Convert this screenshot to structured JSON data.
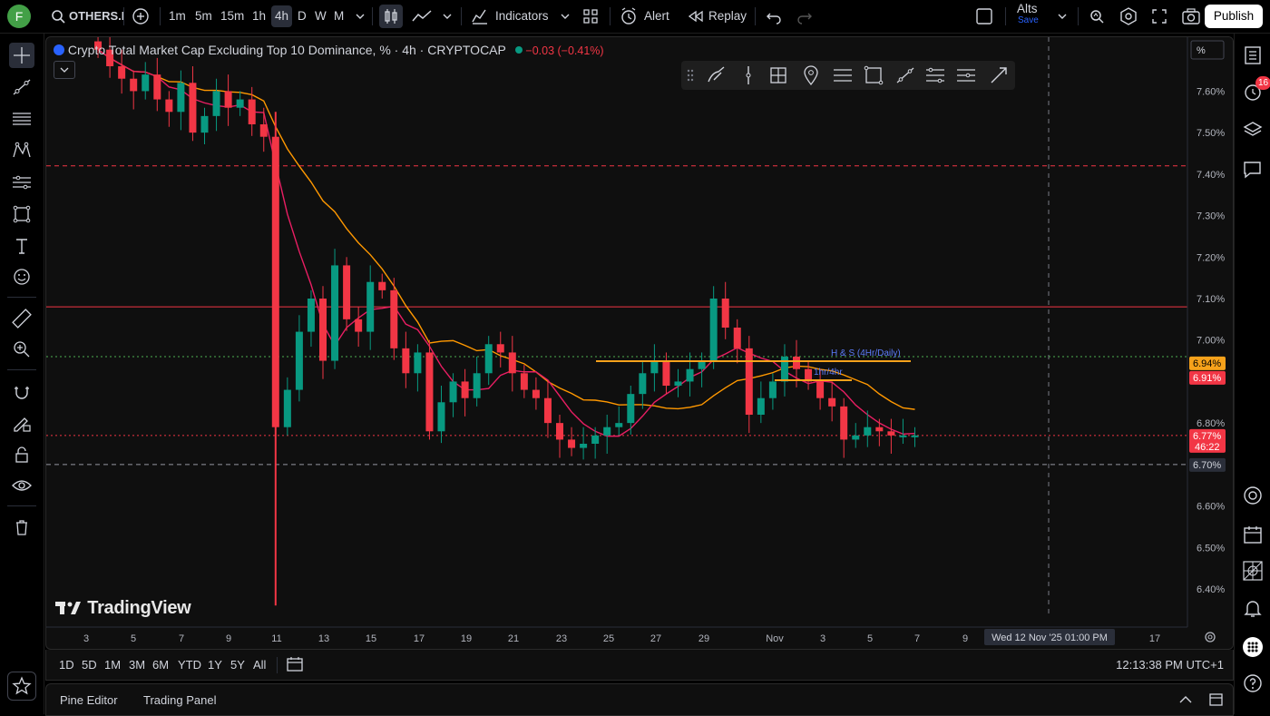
{
  "toolbar": {
    "avatar_letter": "F",
    "symbol": "OTHERS.I",
    "timeframes": [
      "1m",
      "5m",
      "15m",
      "1h",
      "4h",
      "D",
      "W",
      "M"
    ],
    "active_timeframe": "4h",
    "indicators_label": "Indicators",
    "alert_label": "Alert",
    "replay_label": "Replay",
    "layout_name": "Alts",
    "layout_status": "Save",
    "publish_label": "Publish"
  },
  "legend": {
    "title": "Crypto Total Market Cap Excluding Top 10 Dominance, % · 4h · CRYPTOCAP",
    "change": "−0.03 (−0.41%)"
  },
  "price_axis": {
    "unit_label": "%",
    "ticks": [
      "7.60%",
      "7.50%",
      "7.40%",
      "7.30%",
      "7.20%",
      "7.10%",
      "7.00%",
      "6.80%",
      "6.60%",
      "6.50%",
      "6.40%"
    ],
    "tags": [
      {
        "text": "6.94%",
        "bg": "#f7a21b",
        "fg": "#000000"
      },
      {
        "text": "6.91%",
        "bg": "#f23645",
        "fg": "#ffffff"
      },
      {
        "text": "6.77%",
        "text2": "46:22",
        "bg": "#f23645",
        "fg": "#ffffff"
      },
      {
        "text": "6.70%",
        "bg": "#2a2e39",
        "fg": "#d1d4dc"
      }
    ]
  },
  "time_axis": {
    "ticks": [
      "3",
      "5",
      "7",
      "9",
      "11",
      "13",
      "15",
      "17",
      "19",
      "21",
      "23",
      "25",
      "27",
      "29",
      "Nov",
      "3",
      "5",
      "7",
      "9",
      "17"
    ],
    "crosshair_label": "Wed 12 Nov '25    01:00 PM"
  },
  "annotations": {
    "hs_label": "H & S (4Hr/Daily)",
    "tf_label": "1hr/4hr"
  },
  "chart_data": {
    "type": "candlestick",
    "title": "Crypto Total Market Cap Excluding Top 10 Dominance, % · 4h · CRYPTOCAP",
    "y_unit": "%",
    "ylim": [
      6.33,
      7.73
    ],
    "x_range": [
      "Oct 2",
      "Nov 18"
    ],
    "horizontal_lines": [
      {
        "value": 7.42,
        "style": "dashed",
        "color": "#f23645"
      },
      {
        "value": 7.08,
        "style": "solid",
        "color": "#f23645"
      },
      {
        "value": 6.96,
        "style": "dotted",
        "color": "#4caf50"
      },
      {
        "value": 6.77,
        "style": "dotted",
        "color": "#f23645"
      },
      {
        "value": 6.7,
        "style": "dashed",
        "color": "#9598a1"
      }
    ],
    "series": [
      {
        "name": "close",
        "x_days": [
          0.5,
          1.0,
          1.5,
          2.0,
          2.5,
          3.0,
          3.5,
          4.0,
          4.5,
          5.0,
          5.5,
          6.0,
          6.5,
          7.0,
          7.5,
          8.0,
          8.5,
          9.0,
          9.5,
          10.0,
          10.5,
          11.0,
          11.5,
          12.0,
          12.5,
          13.0,
          13.5,
          14.0,
          14.5,
          15.0,
          15.5,
          16.0,
          16.5,
          17.0,
          17.5,
          18.0,
          18.5,
          19.0,
          19.5,
          20.0,
          20.5,
          21.0,
          21.5,
          22.0,
          22.5,
          23.0,
          23.5,
          24.0,
          24.5,
          25.0,
          25.5,
          26.0,
          26.5,
          27.0,
          27.5,
          28.0,
          28.5,
          29.0,
          29.5,
          30.0,
          30.5,
          31.0,
          31.5,
          32.0,
          32.5,
          33.0,
          33.5,
          34.0,
          34.5,
          35.0
        ],
        "values": [
          7.7,
          7.66,
          7.63,
          7.6,
          7.64,
          7.58,
          7.55,
          7.62,
          7.5,
          7.54,
          7.6,
          7.56,
          7.58,
          7.52,
          7.49,
          6.79,
          6.88,
          7.02,
          7.1,
          6.95,
          7.18,
          7.05,
          7.02,
          7.14,
          7.12,
          6.98,
          6.92,
          6.97,
          6.78,
          6.85,
          6.9,
          6.86,
          6.92,
          6.99,
          6.97,
          6.92,
          6.88,
          6.86,
          6.8,
          6.76,
          6.74,
          6.75,
          6.77,
          6.79,
          6.8,
          6.87,
          6.92,
          6.95,
          6.89,
          6.9,
          6.93,
          6.95,
          7.1,
          7.03,
          6.98,
          6.82,
          6.86,
          6.9,
          6.96,
          6.93,
          6.9,
          6.86,
          6.84,
          6.76,
          6.77,
          6.79,
          6.78,
          6.77,
          6.77,
          6.77
        ]
      },
      {
        "name": "MA (pink)",
        "color": "#e91e63"
      },
      {
        "name": "MA (orange)",
        "color": "#ff9800"
      }
    ]
  },
  "range_bar": {
    "ranges": [
      "1D",
      "5D",
      "1M",
      "3M",
      "6M",
      "YTD",
      "1Y",
      "5Y",
      "All"
    ],
    "clock": "12:13:38 PM UTC+1"
  },
  "bottom_panel": {
    "tabs": [
      "Pine Editor",
      "Trading Panel"
    ]
  },
  "watermark": "TradingView",
  "right_sidebar": {
    "badge": "16"
  }
}
